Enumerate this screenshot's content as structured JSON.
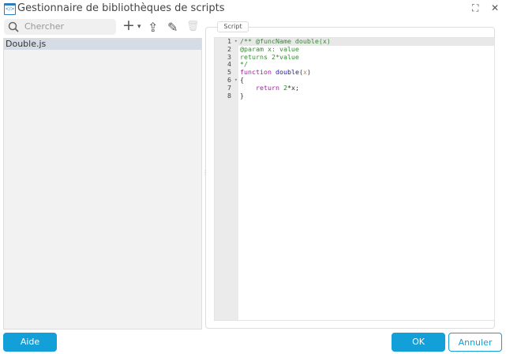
{
  "window": {
    "title": "Gestionnaire de bibliothèques de scripts",
    "maximize_icon": "⛶",
    "close_icon": "✕"
  },
  "sidebar": {
    "search_placeholder": "Chercher",
    "toolbar": {
      "add": "+",
      "add_dropdown": "▾",
      "export": "⇪",
      "edit": "✎",
      "delete": "🗑"
    },
    "items": [
      {
        "label": "Double.js",
        "selected": true
      }
    ]
  },
  "editor": {
    "tab_label": "Script",
    "line_numbers": [
      "1",
      "2",
      "3",
      "4",
      "5",
      "6",
      "7",
      "8"
    ],
    "lines": [
      [
        {
          "t": "/** @funcName double(x)",
          "c": "c"
        }
      ],
      [
        {
          "t": "@param x: value",
          "c": "c"
        }
      ],
      [
        {
          "t": "returns 2*value",
          "c": "c"
        }
      ],
      [
        {
          "t": "*/",
          "c": "c"
        }
      ],
      [
        {
          "t": "function",
          "c": "k"
        },
        {
          "t": " "
        },
        {
          "t": "double",
          "c": "f"
        },
        {
          "t": "("
        },
        {
          "t": "x",
          "c": "p"
        },
        {
          "t": ")"
        }
      ],
      [
        {
          "t": "{"
        }
      ],
      [
        {
          "t": "    "
        },
        {
          "t": "return",
          "c": "k"
        },
        {
          "t": " "
        },
        {
          "t": "2",
          "c": "n"
        },
        {
          "t": "*x;"
        }
      ],
      [
        {
          "t": "}"
        }
      ]
    ]
  },
  "footer": {
    "help": "Aide",
    "ok": "OK",
    "cancel": "Annuler"
  }
}
